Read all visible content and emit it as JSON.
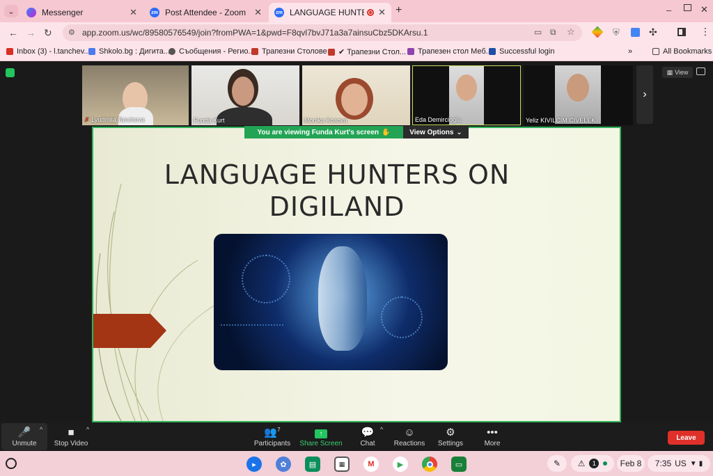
{
  "browser": {
    "tabs": [
      {
        "title": "Messenger",
        "icon": "messenger-icon",
        "active": false
      },
      {
        "title": "Post Attendee - Zoom",
        "icon": "zoom-icon",
        "active": false
      },
      {
        "title": "LANGUAGE HUNTERS ON D",
        "icon": "zoom-icon",
        "active": true
      }
    ],
    "favicon_label": "zm",
    "close_glyph": "✕",
    "new_tab_glyph": "+",
    "tab_menu_glyph": "⌄",
    "url": "app.zoom.us/wc/89580576549/join?fromPWA=1&pwd=F8qvl7bvJ71a3a7ainsuCbz5DKArsu.1",
    "bookmarks": [
      {
        "label": "Inbox (3) - l.tanchev...",
        "icon": "gmail-icon",
        "color": "#d93025"
      },
      {
        "label": "Shkolo.bg : Дигита...",
        "icon": "shkolo-icon",
        "color": "#4b7bec"
      },
      {
        "label": "Съобщения - Регио...",
        "icon": "messages-icon",
        "color": "#555555"
      },
      {
        "label": "Трапезни Столове",
        "icon": "store-icon",
        "color": "#c0392b"
      },
      {
        "label": "✔ Трапезни Стол...",
        "icon": "store-icon",
        "color": "#c0392b"
      },
      {
        "label": "Трапезен стол Меб...",
        "icon": "store-icon",
        "color": "#8e44ad"
      },
      {
        "label": "Successful login",
        "icon": "eu-icon",
        "color": "#1e4fa3"
      }
    ],
    "all_bookmarks": "All Bookmarks"
  },
  "zoom": {
    "participants": [
      {
        "name": "Lyudmila Tancheva",
        "muted": true
      },
      {
        "name": "Funda Kurt",
        "muted": false
      },
      {
        "name": "Monika Kosova",
        "muted": false
      },
      {
        "name": "Eda Demircioglu",
        "muted": false
      },
      {
        "name": "Yeliz KIVILCIM CIVELEK",
        "muted": false
      }
    ],
    "view_label": "View",
    "share_banner": "You are viewing  Funda Kurt's screen",
    "view_options": "View Options",
    "slide_title": "LANGUAGE HUNTERS ON DIGILAND",
    "toolbar": [
      {
        "label": "Unmute",
        "icon": "mic-muted-icon"
      },
      {
        "label": "Stop Video",
        "icon": "video-icon"
      },
      {
        "label": "Participants",
        "icon": "participants-icon",
        "badge": "7"
      },
      {
        "label": "Share Screen",
        "icon": "share-screen-icon"
      },
      {
        "label": "Chat",
        "icon": "chat-icon"
      },
      {
        "label": "Reactions",
        "icon": "reactions-icon"
      },
      {
        "label": "Settings",
        "icon": "gear-icon"
      },
      {
        "label": "More",
        "icon": "more-icon"
      }
    ],
    "leave_label": "Leave",
    "accent_green": "#2fb35a",
    "leave_red": "#e0302a"
  },
  "shelf": {
    "date": "Feb 8",
    "time": "7:35",
    "locale": "US",
    "notification_count": "1"
  }
}
